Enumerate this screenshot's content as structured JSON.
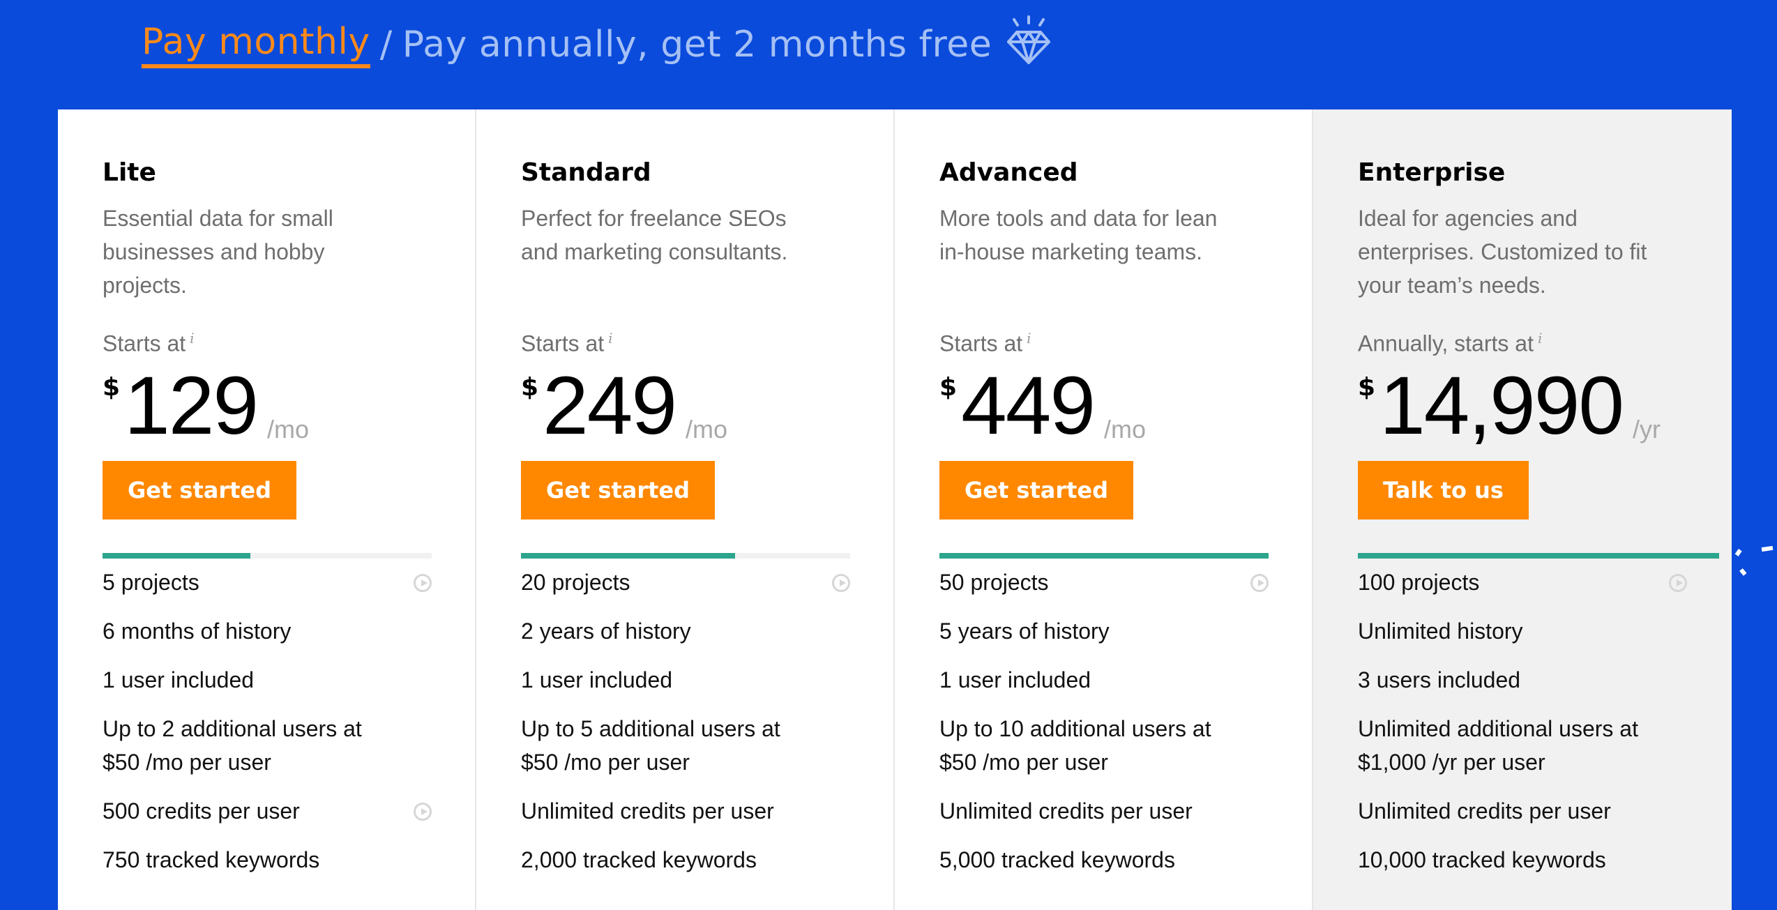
{
  "billing_toggle": {
    "monthly_label": "Pay monthly",
    "separator": "/",
    "annual_label": "Pay annually, get 2 months free",
    "selected": "monthly",
    "icon": "diamond-icon"
  },
  "colors": {
    "background": "#0a4bdb",
    "accent_orange": "#ff8800",
    "progress_teal": "#2ca58d",
    "enterprise_card": "#f1f1f1"
  },
  "plans": [
    {
      "name": "Lite",
      "description": "Essential data for small businesses and hobby projects.",
      "starts_label": "Starts at",
      "info_glyph": "i",
      "currency": "$",
      "price": "129",
      "period": "/mo",
      "cta": "Get started",
      "progress_percent": 45,
      "features": [
        {
          "text": "5 projects",
          "video": true
        },
        {
          "text": "6 months of history",
          "video": false
        },
        {
          "text": "1 user included",
          "video": false
        },
        {
          "text": "Up to 2 additional users at $50 /mo per user",
          "video": false
        },
        {
          "text": "500 credits per user",
          "video": true
        },
        {
          "text": "750 tracked keywords",
          "video": false
        }
      ]
    },
    {
      "name": "Standard",
      "description": "Perfect for freelance SEOs and marketing consultants.",
      "starts_label": "Starts at",
      "info_glyph": "i",
      "currency": "$",
      "price": "249",
      "period": "/mo",
      "cta": "Get started",
      "progress_percent": 65,
      "features": [
        {
          "text": "20 projects",
          "video": true
        },
        {
          "text": "2 years of history",
          "video": false
        },
        {
          "text": "1 user included",
          "video": false
        },
        {
          "text": "Up to 5 additional users at $50 /mo per user",
          "video": false
        },
        {
          "text": "Unlimited credits per user",
          "video": false
        },
        {
          "text": "2,000 tracked keywords",
          "video": false
        }
      ]
    },
    {
      "name": "Advanced",
      "description": "More tools and data for lean in-house marketing teams.",
      "starts_label": "Starts at",
      "info_glyph": "i",
      "currency": "$",
      "price": "449",
      "period": "/mo",
      "cta": "Get started",
      "progress_percent": 100,
      "features": [
        {
          "text": "50 projects",
          "video": true
        },
        {
          "text": "5 years of history",
          "video": false
        },
        {
          "text": "1 user included",
          "video": false
        },
        {
          "text": "Up to 10 additional users at $50 /mo per user",
          "video": false
        },
        {
          "text": "Unlimited credits per user",
          "video": false
        },
        {
          "text": "5,000 tracked keywords",
          "video": false
        }
      ]
    },
    {
      "name": "Enterprise",
      "description": "Ideal for agencies and enterprises. Customized to fit your team’s needs.",
      "starts_label": "Annually, starts at",
      "info_glyph": "i",
      "currency": "$",
      "price": "14,990",
      "period": "/yr",
      "cta": "Talk to us",
      "progress_percent": 100,
      "features": [
        {
          "text": "100 projects",
          "video": true
        },
        {
          "text": "Unlimited history",
          "video": false
        },
        {
          "text": "3 users included",
          "video": false
        },
        {
          "text": "Unlimited additional users at $1,000 /yr per user",
          "video": false
        },
        {
          "text": "Unlimited credits per user",
          "video": false
        },
        {
          "text": "10,000 tracked keywords",
          "video": false
        }
      ]
    }
  ]
}
